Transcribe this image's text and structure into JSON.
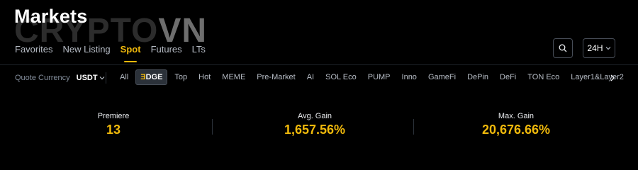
{
  "header": {
    "title": "Markets"
  },
  "watermark": {
    "part1": "CRYPTO",
    "part2": "VN"
  },
  "nav_tabs": [
    {
      "label": "Favorites",
      "active": false
    },
    {
      "label": "New Listing",
      "active": false
    },
    {
      "label": "Spot",
      "active": true
    },
    {
      "label": "Futures",
      "active": false
    },
    {
      "label": "LTs",
      "active": false
    }
  ],
  "controls": {
    "search_icon": "search-icon",
    "period_label": "24H"
  },
  "quote": {
    "label": "Quote Currency",
    "value": "USDT"
  },
  "categories": [
    "All",
    "EDGE",
    "Top",
    "Hot",
    "MEME",
    "Pre-Market",
    "AI",
    "SOL Eco",
    "PUMP",
    "Inno",
    "GameFi",
    "DePin",
    "DeFi",
    "TON Eco",
    "Layer1&Layer2"
  ],
  "stats": [
    {
      "label": "Premiere",
      "value": "13"
    },
    {
      "label": "Avg. Gain",
      "value": "1,657.56%"
    },
    {
      "label": "Max. Gain",
      "value": "20,676.66%"
    }
  ],
  "colors": {
    "accent": "#f0b90b",
    "background": "#000000",
    "muted_text": "#848e9c"
  }
}
